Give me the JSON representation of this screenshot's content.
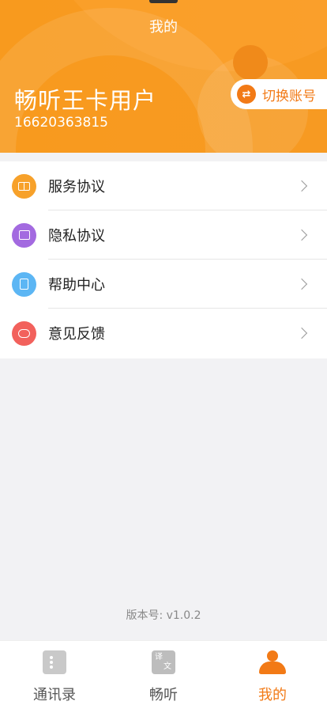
{
  "header": {
    "title": "我的",
    "user_name": "畅听王卡用户",
    "phone": "16620363815",
    "switch_account_label": "切换账号",
    "switch_icon_text": "⇄",
    "background_color": "#f89a1e"
  },
  "menu": {
    "items": [
      {
        "label": "服务协议",
        "icon": "book-icon",
        "color": "#f7a12a"
      },
      {
        "label": "隐私协议",
        "icon": "privacy-lock-icon",
        "color": "#a36ae0"
      },
      {
        "label": "帮助中心",
        "icon": "help-document-icon",
        "color": "#5cb6f4"
      },
      {
        "label": "意见反馈",
        "icon": "chat-bubble-icon",
        "color": "#f2615c"
      }
    ]
  },
  "version_text": "版本号: v1.0.2",
  "tabbar": {
    "tabs": [
      {
        "label": "通讯录",
        "icon": "contacts-icon",
        "active": false
      },
      {
        "label": "畅听",
        "icon": "translate-icon",
        "active": false,
        "icon_text_1": "译",
        "icon_text_2": "文"
      },
      {
        "label": "我的",
        "icon": "user-icon",
        "active": true
      }
    ],
    "active_color": "#f27a16"
  }
}
